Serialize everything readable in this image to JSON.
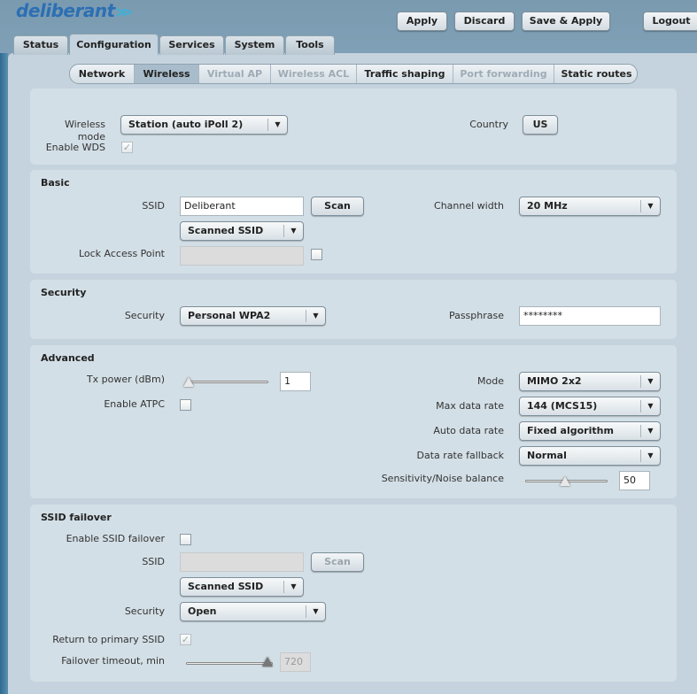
{
  "brand": {
    "logo": "deliberant"
  },
  "header": {
    "apply": "Apply",
    "discard": "Discard",
    "save_apply": "Save & Apply",
    "logout": "Logout"
  },
  "tabs": [
    "Status",
    "Configuration",
    "Services",
    "System",
    "Tools"
  ],
  "subtabs": [
    "Network",
    "Wireless",
    "Virtual AP",
    "Wireless ACL",
    "Traffic shaping",
    "Port forwarding",
    "Static routes"
  ],
  "general": {
    "wireless_mode_label": "Wireless mode",
    "wireless_mode": "Station (auto iPoll 2)",
    "country_label": "Country",
    "country": "US",
    "wds_label": "Enable WDS"
  },
  "basic": {
    "title": "Basic",
    "ssid_label": "SSID",
    "ssid": "Deliberant",
    "scan": "Scan",
    "scanned_ssid": "Scanned SSID",
    "lock_ap_label": "Lock Access Point",
    "channel_width_label": "Channel width",
    "channel_width": "20 MHz"
  },
  "security": {
    "title": "Security",
    "security_label": "Security",
    "security": "Personal WPA2",
    "passphrase_label": "Passphrase",
    "passphrase": "********"
  },
  "advanced": {
    "title": "Advanced",
    "tx_power_label": "Tx power (dBm)",
    "tx_power": "1",
    "atpc_label": "Enable ATPC",
    "mode_label": "Mode",
    "mode": "MIMO 2x2",
    "max_rate_label": "Max data rate",
    "max_rate": "144 (MCS15)",
    "auto_rate_label": "Auto data rate",
    "auto_rate": "Fixed algorithm",
    "fallback_label": "Data rate fallback",
    "fallback": "Normal",
    "sens_label": "Sensitivity/Noise balance",
    "sens": "50"
  },
  "failover": {
    "title": "SSID failover",
    "enable_label": "Enable SSID failover",
    "ssid_label": "SSID",
    "scan": "Scan",
    "scanned_ssid": "Scanned SSID",
    "security_label": "Security",
    "security": "Open",
    "return_label": "Return to primary SSID",
    "timeout_label": "Failover timeout, min",
    "timeout": "720"
  }
}
